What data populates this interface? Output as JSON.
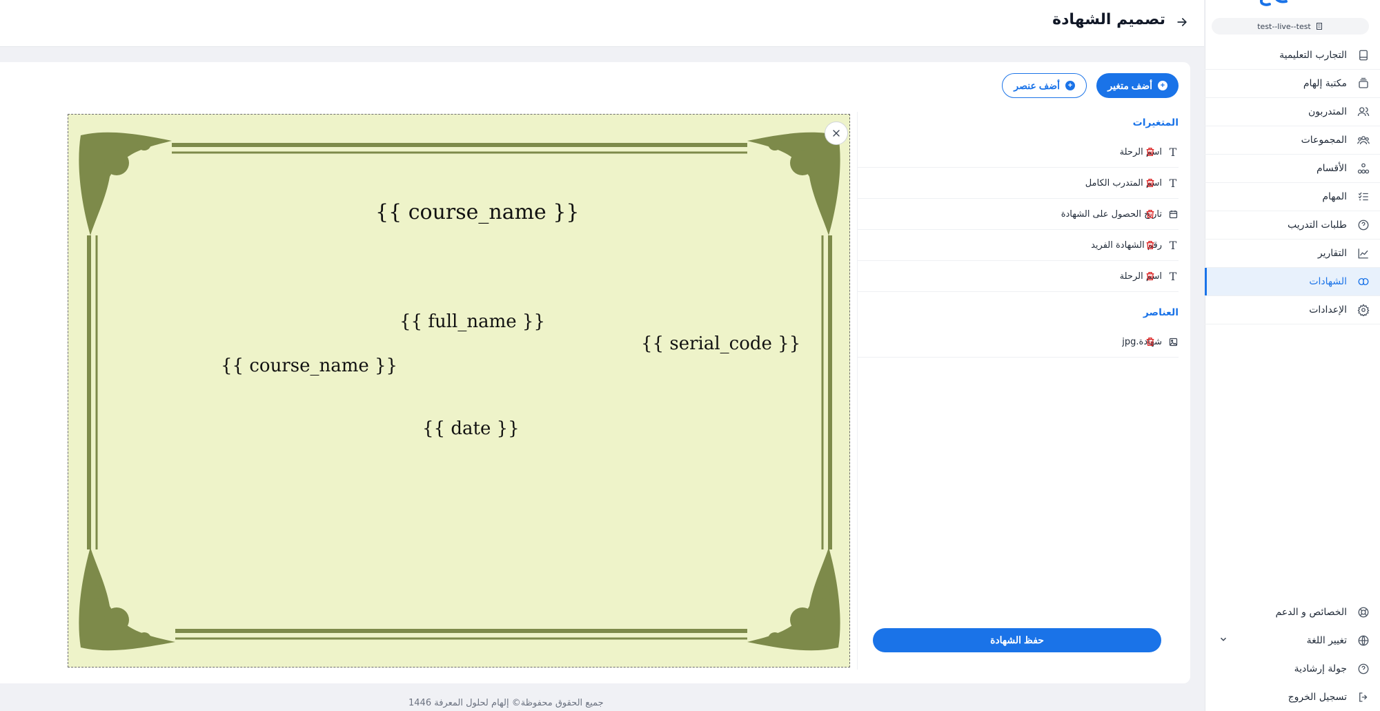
{
  "sidebar": {
    "tenant": "test--live--test",
    "items": [
      {
        "label": "التجارب التعليمية",
        "icon": "tablet-icon"
      },
      {
        "label": "مكتبة إلهام",
        "icon": "library-icon"
      },
      {
        "label": "المتدربون",
        "icon": "users-icon"
      },
      {
        "label": "المجموعات",
        "icon": "group-icon"
      },
      {
        "label": "الأقسام",
        "icon": "hierarchy-icon"
      },
      {
        "label": "المهام",
        "icon": "tasks-icon"
      },
      {
        "label": "طلبات التدريب",
        "icon": "help-circle-icon"
      },
      {
        "label": "التقارير",
        "icon": "chart-icon"
      },
      {
        "label": "الشهادات",
        "icon": "certificate-icon",
        "active": true
      },
      {
        "label": "الإعدادات",
        "icon": "gear-icon"
      }
    ],
    "bottom": [
      {
        "label": "الخصائص و الدعم",
        "icon": "lifebuoy-icon"
      },
      {
        "label": "تغيير اللغة",
        "icon": "globe-icon"
      },
      {
        "label": "جولة إرشادية",
        "icon": "help-circle-icon"
      },
      {
        "label": "تسجيل الخروج",
        "icon": "logout-icon"
      }
    ]
  },
  "header": {
    "title": "تصميم الشهادة"
  },
  "toolbar": {
    "add_variable": "أضف متغير",
    "add_element": "أضف عنصر"
  },
  "variables": {
    "title": "المتغيرات",
    "items": [
      {
        "label": "اسم الرحلة",
        "type": "text"
      },
      {
        "label": "اسم المتدرب الكامل",
        "type": "text"
      },
      {
        "label": "تاريخ الحصول على الشهادة",
        "type": "date"
      },
      {
        "label": "رقم الشهادة الفريد",
        "type": "text"
      },
      {
        "label": "اسم الرحلة",
        "type": "text"
      }
    ]
  },
  "elements": {
    "title": "العناصر",
    "items": [
      {
        "label": "شهادة.jpg",
        "type": "image"
      }
    ]
  },
  "save_label": "حفظ الشهادة",
  "canvas": {
    "placeholders": {
      "course_name_top": "{{ course_name }}",
      "full_name": "{{ full_name }}",
      "serial_code": "{{ serial_code }}",
      "course_name_left": "{{ course_name }}",
      "date": "{{ date }}"
    },
    "background_color": "#eef3c9",
    "frame_color": "#7d8a4a"
  },
  "footer": "جميع الحقوق محفوظة© إلهام لحلول المعرفة 1446",
  "colors": {
    "accent": "#1a73e8",
    "danger": "#dc2626"
  }
}
